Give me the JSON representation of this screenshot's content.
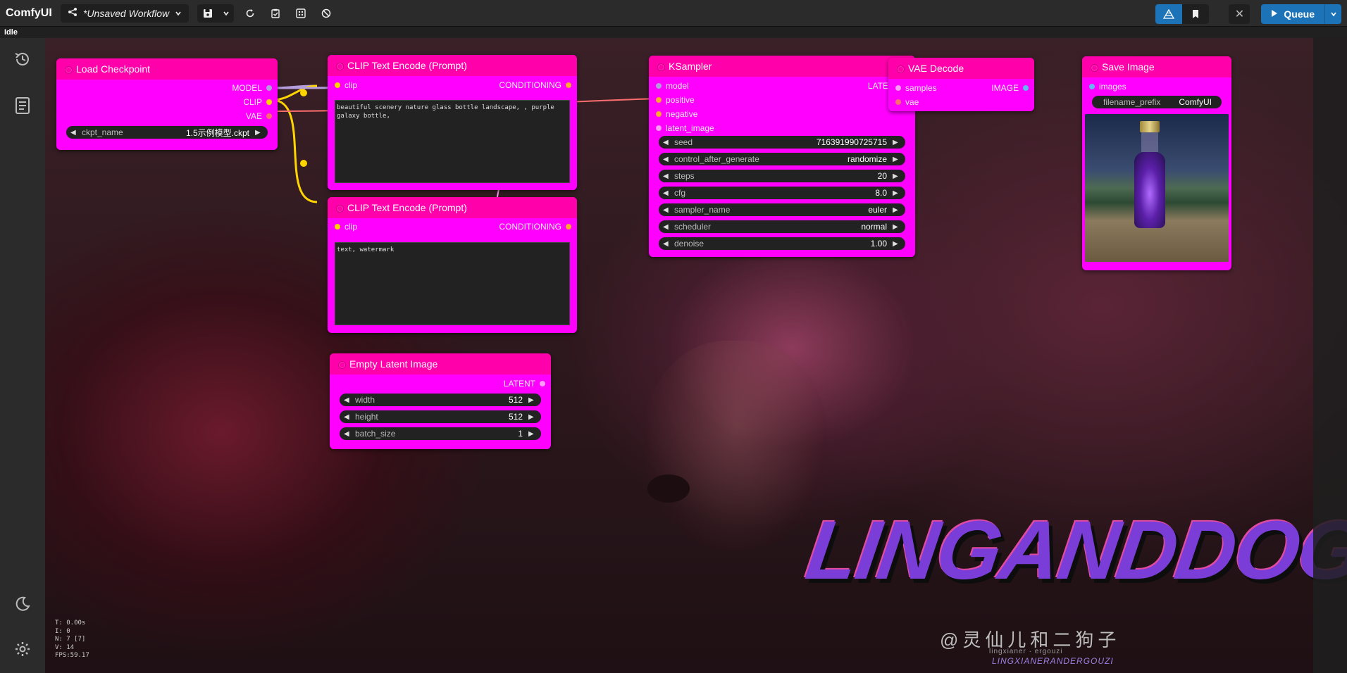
{
  "app": {
    "brand": "ComfyUI",
    "workflow_title": "*Unsaved Workflow",
    "status": "Idle",
    "queue_label": "Queue"
  },
  "stats": [
    "T: 0.00s",
    "I: 0",
    "N: 7 [7]",
    "V: 14",
    "FPS:59.17"
  ],
  "icons": {
    "share": "share-icon",
    "save": "save-icon",
    "refresh": "refresh-icon",
    "clipboard": "clipboard-icon",
    "fit": "fit-view-icon",
    "clear": "clear-icon",
    "history": "history-icon",
    "library": "library-icon",
    "theme": "moon-icon",
    "settings": "gear-icon"
  },
  "colors": {
    "node_body": "#ff00ff",
    "node_title": "#ff00aa",
    "accent": "#1c73b8"
  },
  "nodes": {
    "load_checkpoint": {
      "title": "Load Checkpoint",
      "outputs": [
        "MODEL",
        "CLIP",
        "VAE"
      ],
      "ckpt_label": "ckpt_name",
      "ckpt_value": "1.5示例模型.ckpt"
    },
    "clip_pos": {
      "title": "CLIP Text Encode (Prompt)",
      "input": "clip",
      "output": "CONDITIONING",
      "text": "beautiful scenery nature glass bottle landscape, , purple galaxy bottle,"
    },
    "clip_neg": {
      "title": "CLIP Text Encode (Prompt)",
      "input": "clip",
      "output": "CONDITIONING",
      "text": "text, watermark"
    },
    "empty_latent": {
      "title": "Empty Latent Image",
      "output": "LATENT",
      "widgets": [
        {
          "label": "width",
          "value": "512"
        },
        {
          "label": "height",
          "value": "512"
        },
        {
          "label": "batch_size",
          "value": "1"
        }
      ]
    },
    "ksampler": {
      "title": "KSampler",
      "inputs": [
        "model",
        "positive",
        "negative",
        "latent_image"
      ],
      "output": "LATENT",
      "widgets": [
        {
          "label": "seed",
          "value": "716391990725715"
        },
        {
          "label": "control_after_generate",
          "value": "randomize"
        },
        {
          "label": "steps",
          "value": "20"
        },
        {
          "label": "cfg",
          "value": "8.0"
        },
        {
          "label": "sampler_name",
          "value": "euler"
        },
        {
          "label": "scheduler",
          "value": "normal"
        },
        {
          "label": "denoise",
          "value": "1.00"
        }
      ]
    },
    "vae_decode": {
      "title": "VAE Decode",
      "inputs": [
        "samples",
        "vae"
      ],
      "output": "IMAGE"
    },
    "save_image": {
      "title": "Save Image",
      "input": "images",
      "prefix_label": "filename_prefix",
      "prefix_value": "ComfyUI"
    }
  },
  "background_art": {
    "logo_text": "LINGANDDOG",
    "handle": "@灵仙儿和二狗子",
    "tag1": "lingxianer · ergouzi",
    "tag2": "LINGXIANERANDERGOUZI"
  }
}
